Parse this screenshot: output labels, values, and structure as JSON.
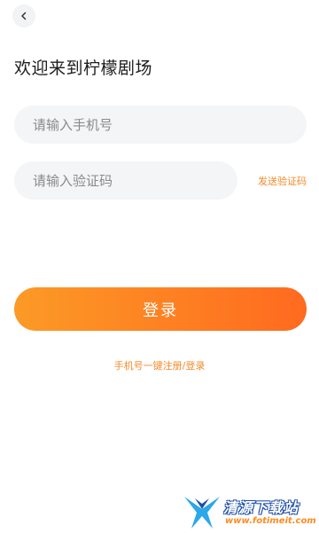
{
  "header": {
    "back_icon": "chevron-left-icon"
  },
  "title": "欢迎来到柠檬剧场",
  "form": {
    "phone_placeholder": "请输入手机号",
    "code_placeholder": "请输入验证码",
    "send_code_label": "发送验证码",
    "login_label": "登录",
    "one_key_label": "手机号一键注册/登录"
  },
  "watermark": {
    "name": "清源下载站",
    "url": "www.fotimeit.com"
  },
  "colors": {
    "accent": "#f58a2a",
    "button_start": "#fc9a26",
    "button_end": "#ff6a1f",
    "input_bg": "#f4f5f7"
  }
}
